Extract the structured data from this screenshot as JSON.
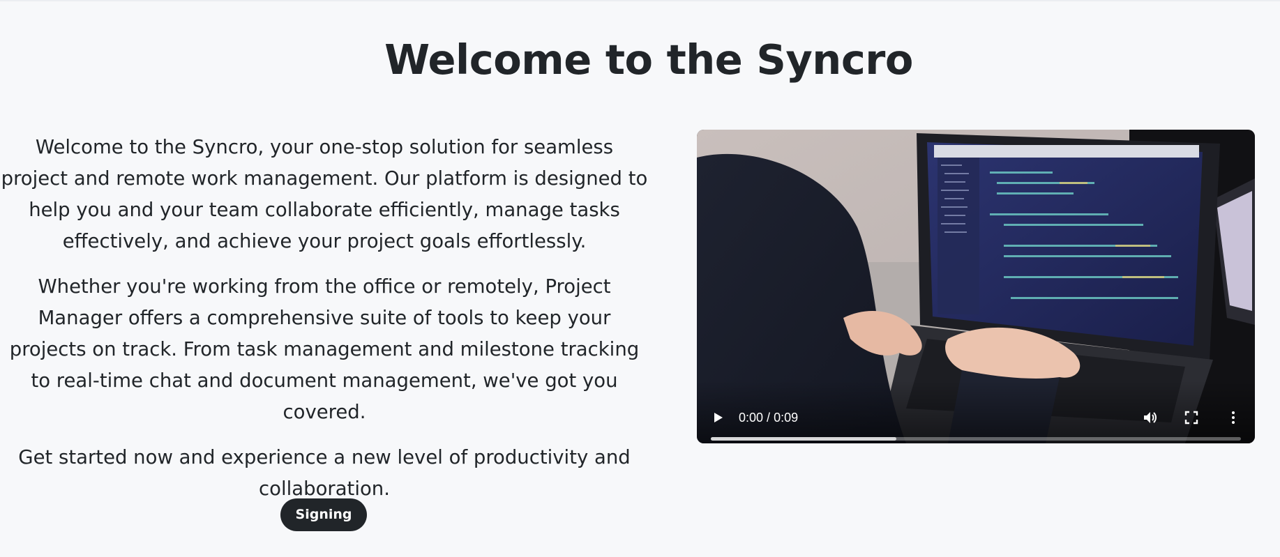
{
  "page": {
    "title": "Welcome to the Syncro"
  },
  "intro": {
    "paragraphs": [
      "Welcome to the Syncro, your one-stop solution for seamless project and remote work management. Our platform is designed to help you and your team collaborate efficiently, manage tasks effectively, and achieve your project goals effortlessly.",
      "Whether you're working from the office or remotely, Project Manager offers a comprehensive suite of tools to keep your projects on track. From task management and milestone tracking to real-time chat and document management, we've got you covered.",
      "Get started now and experience a new level of productivity and collaboration."
    ]
  },
  "cta": {
    "label": "Signing"
  },
  "video": {
    "current_time": "0:00",
    "separator": "/",
    "duration": "0:09",
    "buffered_fraction": 0.35,
    "icons": {
      "play": "play-icon",
      "volume": "volume-icon",
      "fullscreen": "fullscreen-icon",
      "more": "more-vertical-icon"
    }
  },
  "colors": {
    "background": "#f7f8fa",
    "text": "#212529",
    "button_bg": "#212529",
    "button_text": "#ffffff",
    "video_bg": "#0d0d10"
  }
}
